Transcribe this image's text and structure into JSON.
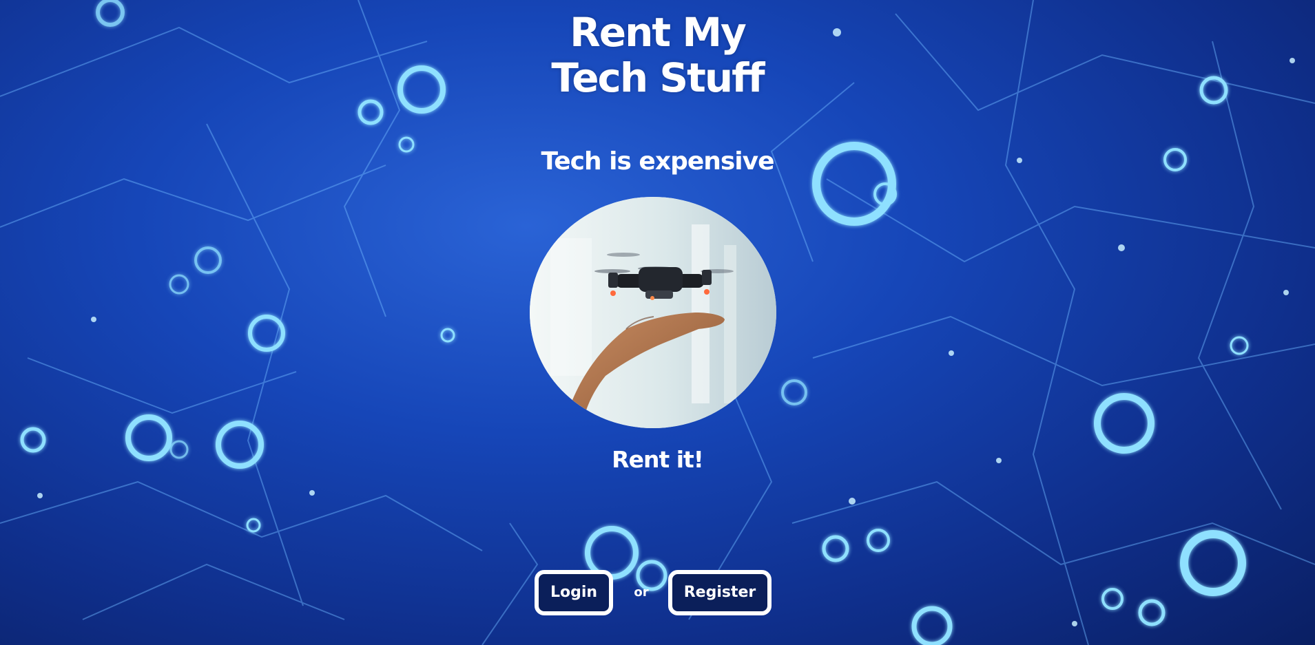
{
  "page": {
    "title_line1": "Rent My",
    "title_line2": "Tech Stuff",
    "tagline": "Tech is expensive",
    "cta": "Rent it!",
    "login_label": "Login",
    "or_text": "or",
    "register_label": "Register"
  },
  "hero_image": {
    "subject": "hand-holding-drone"
  },
  "colors": {
    "background": "#1646b8",
    "circuit_glow": "#7fd0ff",
    "text": "#ffffff",
    "button_fill": "#0b1f5a",
    "button_border": "#ffffff"
  }
}
